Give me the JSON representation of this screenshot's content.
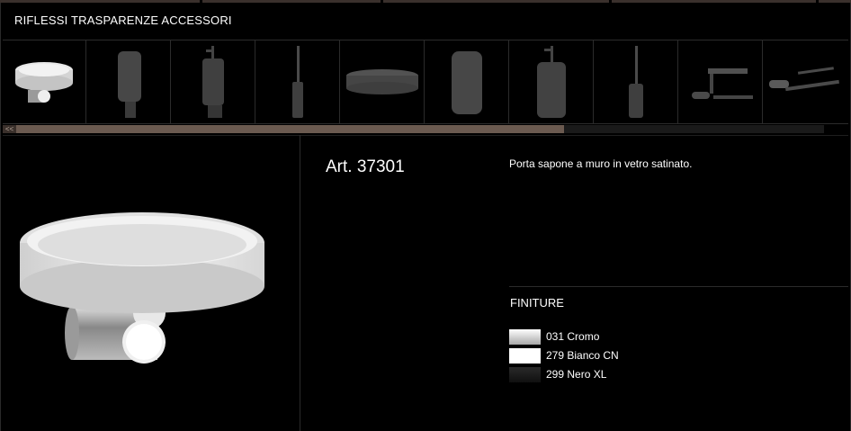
{
  "header": {
    "title": "RIFLESSI TRASPARENZE ACCESSORI"
  },
  "thumbnails": [
    {
      "name": "thumb-soap-dish-wall"
    },
    {
      "name": "thumb-tumbler-holder"
    },
    {
      "name": "thumb-soap-dispenser-wall"
    },
    {
      "name": "thumb-toilet-brush-wall"
    },
    {
      "name": "thumb-soap-dish-standing"
    },
    {
      "name": "thumb-tumbler-standing"
    },
    {
      "name": "thumb-soap-dispenser-standing"
    },
    {
      "name": "thumb-toilet-brush-standing"
    },
    {
      "name": "thumb-paper-holder-shelf"
    },
    {
      "name": "thumb-towel-bar"
    }
  ],
  "scrollbar": {
    "back_label": "<<"
  },
  "product": {
    "article": "Art. 37301",
    "description": "Porta sapone a muro in vetro satinato."
  },
  "finishes": {
    "title": "FINITURE",
    "items": [
      {
        "label": "031 Cromo",
        "color": "#d9d9d9"
      },
      {
        "label": "279 Bianco CN",
        "color": "#ffffff"
      },
      {
        "label": "299 Nero XL",
        "color": "#1c1c1c"
      }
    ]
  }
}
